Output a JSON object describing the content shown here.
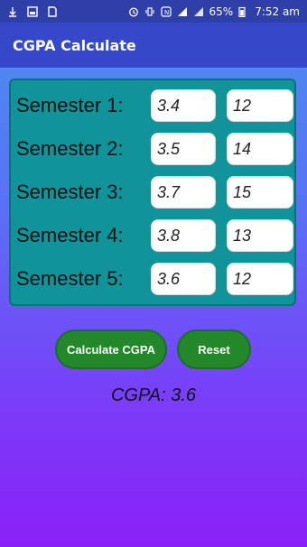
{
  "status_bar": {
    "battery": "65%",
    "time": "7:52 am"
  },
  "app": {
    "title": "CGPA Calculate"
  },
  "semesters": [
    {
      "label": "Semester 1:",
      "gpa": "3.4",
      "credits": "12"
    },
    {
      "label": "Semester 2:",
      "gpa": "3.5",
      "credits": "14"
    },
    {
      "label": "Semester 3:",
      "gpa": "3.7",
      "credits": "15"
    },
    {
      "label": "Semester 4:",
      "gpa": "3.8",
      "credits": "13"
    },
    {
      "label": "Semester 5:",
      "gpa": "3.6",
      "credits": "12"
    }
  ],
  "buttons": {
    "calculate": "Calculate CGPA",
    "reset": "Reset"
  },
  "result": "CGPA: 3.6",
  "colors": {
    "status_bar": "#2f3fa8",
    "app_bar": "#3448c8",
    "panel": "#11939a",
    "button": "#22882a"
  }
}
